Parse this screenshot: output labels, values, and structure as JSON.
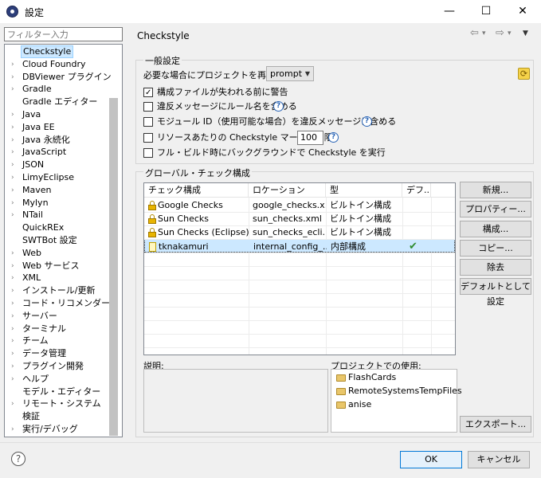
{
  "window": {
    "title": "設定",
    "minimize": "—",
    "maximize": "☐",
    "close": "✕"
  },
  "filter": {
    "placeholder": "フィルター入力"
  },
  "tree": [
    {
      "label": "Checkstyle",
      "chev": "",
      "selected": true
    },
    {
      "label": "Cloud Foundry",
      "chev": "›"
    },
    {
      "label": "DBViewer プラグイン",
      "chev": "›"
    },
    {
      "label": "Gradle",
      "chev": "›"
    },
    {
      "label": "Gradle エディター",
      "chev": ""
    },
    {
      "label": "Java",
      "chev": "›"
    },
    {
      "label": "Java EE",
      "chev": "›"
    },
    {
      "label": "Java 永続化",
      "chev": "›"
    },
    {
      "label": "JavaScript",
      "chev": "›"
    },
    {
      "label": "JSON",
      "chev": "›"
    },
    {
      "label": "LimyEclipse",
      "chev": "›"
    },
    {
      "label": "Maven",
      "chev": "›"
    },
    {
      "label": "Mylyn",
      "chev": "›"
    },
    {
      "label": "NTail",
      "chev": "›"
    },
    {
      "label": "QuickREx",
      "chev": ""
    },
    {
      "label": "SWTBot 設定",
      "chev": ""
    },
    {
      "label": "Web",
      "chev": "›"
    },
    {
      "label": "Web サービス",
      "chev": "›"
    },
    {
      "label": "XML",
      "chev": "›"
    },
    {
      "label": "インストール/更新",
      "chev": "›"
    },
    {
      "label": "コード・リコメンダー",
      "chev": "›"
    },
    {
      "label": "サーバー",
      "chev": "›"
    },
    {
      "label": "ターミナル",
      "chev": "›"
    },
    {
      "label": "チーム",
      "chev": "›"
    },
    {
      "label": "データ管理",
      "chev": "›"
    },
    {
      "label": "プラグイン開発",
      "chev": "›"
    },
    {
      "label": "ヘルプ",
      "chev": "›"
    },
    {
      "label": "モデル・エディター",
      "chev": ""
    },
    {
      "label": "リモート・システム",
      "chev": "›"
    },
    {
      "label": "検証",
      "chev": ""
    },
    {
      "label": "実行/デバッグ",
      "chev": "›"
    }
  ],
  "header": {
    "title": "Checkstyle",
    "back": "⇦",
    "forward": "⇨",
    "menu": "▼",
    "down": "▾"
  },
  "general": {
    "group_label": "一般設定",
    "rebuild_label": "必要な場合にプロジェクトを再ビルド:",
    "rebuild_value": "prompt",
    "options": [
      {
        "label": "構成ファイルが失われる前に警告",
        "checked": true
      },
      {
        "label": "違反メッセージにルール名を含める",
        "checked": false,
        "help": true
      },
      {
        "label": "モジュール ID（使用可能な場合）を違反メッセージに含める",
        "checked": false,
        "help": true
      },
      {
        "label": "リソースあたりの Checkstyle マーカー制限",
        "checked": false,
        "help": true
      },
      {
        "label": "フル・ビルド時にバックグラウンドで Checkstyle を実行",
        "checked": false
      }
    ],
    "marker_limit": "100"
  },
  "global": {
    "group_label": "グローバル・チェック構成",
    "columns": [
      "チェック構成",
      "ロケーション",
      "型",
      "デフ..."
    ],
    "rows": [
      {
        "name": "Google Checks",
        "location": "google_checks.x...",
        "type": "ビルトイン構成",
        "default": "",
        "icon": "lock"
      },
      {
        "name": "Sun Checks",
        "location": "sun_checks.xml",
        "type": "ビルトイン構成",
        "default": "",
        "icon": "lock"
      },
      {
        "name": "Sun Checks (Eclipse)",
        "location": "sun_checks_ecli...",
        "type": "ビルトイン構成",
        "default": "",
        "icon": "lock"
      },
      {
        "name": "tknakamuri",
        "location": "internal_config_...",
        "type": "内部構成",
        "default": "✔",
        "icon": "file",
        "selected": true
      }
    ],
    "buttons": [
      "新規...",
      "プロパティー...",
      "構成...",
      "コピー...",
      "除去",
      "デフォルトとして設定"
    ],
    "export": "エクスポート...",
    "description_label": "説明:",
    "projects_label": "プロジェクトでの使用:",
    "projects": [
      "FlashCards",
      "RemoteSystemsTempFiles",
      "anise"
    ]
  },
  "footer": {
    "help": "?",
    "ok": "OK",
    "cancel": "キャンセル"
  }
}
